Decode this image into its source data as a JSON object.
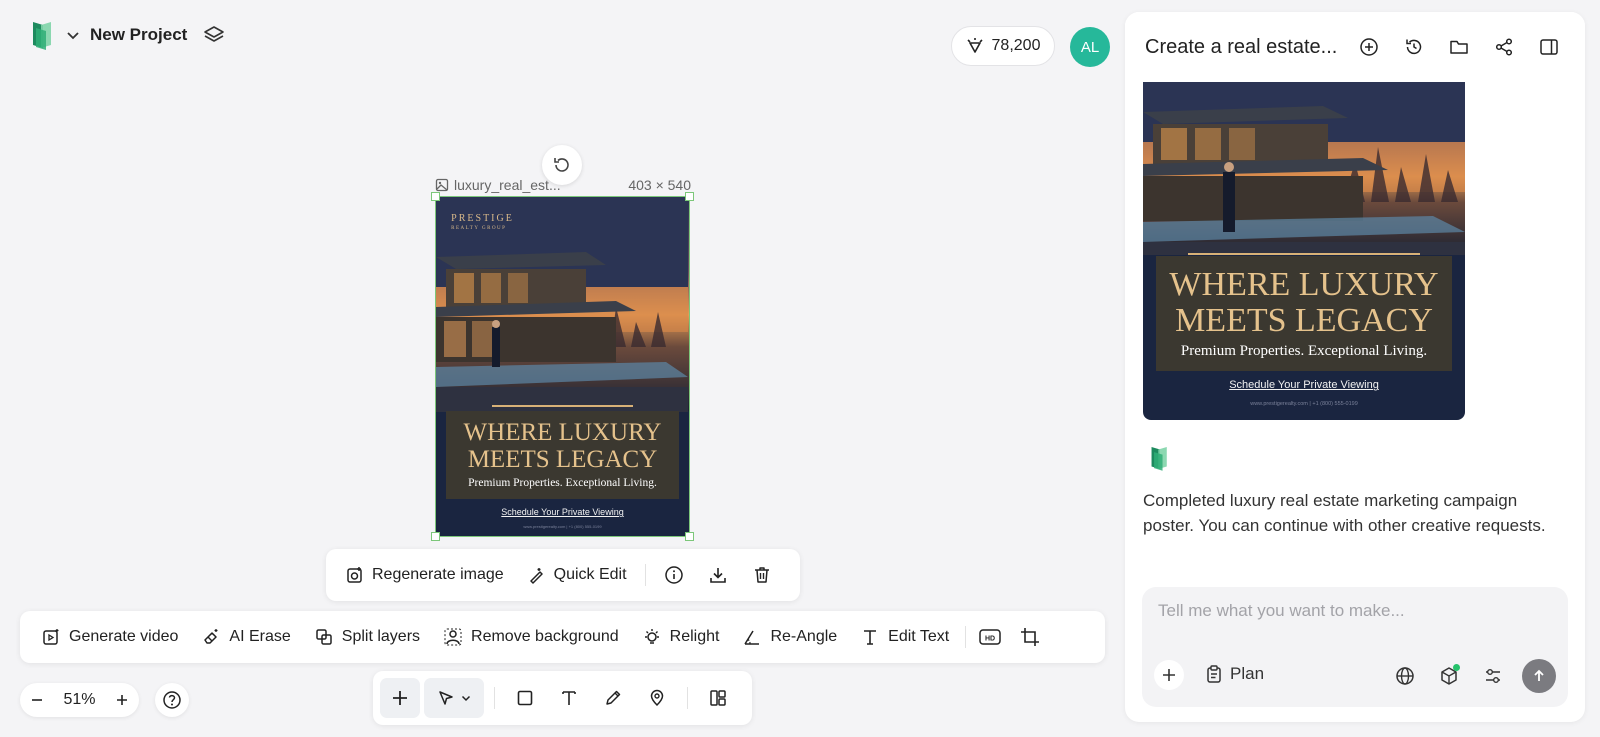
{
  "header": {
    "project_title": "New Project"
  },
  "credits": {
    "value": "78,200"
  },
  "user": {
    "initials": "AL",
    "avatar_color": "#26b89a"
  },
  "canvas": {
    "filename": "luxury_real_est...",
    "dimensions": "403 × 540",
    "selection_color": "#7cc77a"
  },
  "poster": {
    "brand_name": "PRESTIGE",
    "brand_sub": "REALTY GROUP",
    "headline_line1": "WHERE LUXURY",
    "headline_line2": "MEETS LEGACY",
    "tagline": "Premium Properties. Exceptional Living.",
    "cta": "Schedule Your Private Viewing",
    "footer": "www.prestigerealty.com | +1 (800) 555-0199"
  },
  "image_toolbar": {
    "regenerate": "Regenerate image",
    "quick_edit": "Quick Edit"
  },
  "gen_toolbar": {
    "generate_video": "Generate video",
    "ai_erase": "AI Erase",
    "split_layers": "Split layers",
    "remove_background": "Remove background",
    "relight": "Relight",
    "re_angle": "Re-Angle",
    "edit_text": "Edit Text"
  },
  "zoom": {
    "level": "51%"
  },
  "chat": {
    "title": "Create a real estate...",
    "assistant_message": "Completed luxury real estate marketing campaign poster. You can continue with other creative requests.",
    "input_placeholder": "Tell me what you want to make...",
    "plan_label": "Plan"
  },
  "colors": {
    "accent_gold": "#e5c28c",
    "poster_bg": "#1a2540",
    "send_disabled": "#7b7b80"
  }
}
